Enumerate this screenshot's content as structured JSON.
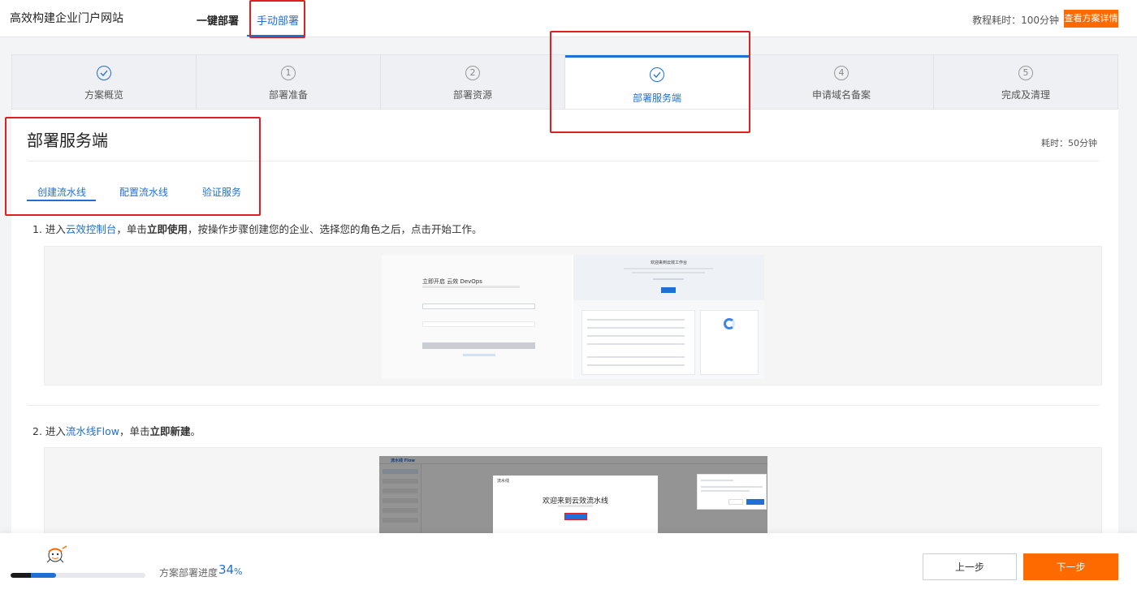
{
  "header": {
    "site_title": "高效构建企业门户网站",
    "tabs": [
      {
        "label": "一键部署"
      },
      {
        "label": "手动部署"
      }
    ],
    "course_time": "教程耗时：100分钟",
    "detail_button": "查看方案详情"
  },
  "steps": [
    {
      "label": "方案概览",
      "status": "done"
    },
    {
      "label": "部署准备",
      "number": "1"
    },
    {
      "label": "部署资源",
      "number": "2"
    },
    {
      "label": "部署服务端",
      "status": "active"
    },
    {
      "label": "申请域名备案",
      "number": "4"
    },
    {
      "label": "完成及清理",
      "number": "5"
    }
  ],
  "section": {
    "title": "部署服务端",
    "elapsed": "耗时：50分钟",
    "sub_tabs": [
      {
        "label": "创建流水线"
      },
      {
        "label": "配置流水线"
      },
      {
        "label": "验证服务"
      }
    ],
    "instructions": [
      {
        "prefix": "1. 进入",
        "link": "云效控制台",
        "mid": "，单击",
        "bold": "立即使用",
        "suffix": "，按操作步骤创建您的企业、选择您的角色之后，点击开始工作。"
      },
      {
        "prefix": "2. 进入",
        "link": "流水线Flow",
        "mid": "，单击",
        "bold": "立即新建",
        "suffix": "。"
      }
    ],
    "screenshot1": {
      "left_title": "立即开启 云效 DevOps",
      "right_title": "欢迎来到云效工作台"
    },
    "screenshot2": {
      "app_name": "流水线 Flow",
      "modal_head": "流水线",
      "modal_title": "欢迎来到云效流水线"
    }
  },
  "footer": {
    "progress_label": "方案部署进度",
    "progress_value": "34",
    "progress_unit": "%",
    "progress_fraction": 0.34,
    "prev_button": "上一步",
    "next_button": "下一步"
  },
  "colors": {
    "accent": "#1f6fd6",
    "brand_orange": "#ff6a00",
    "annotation_red": "#e02020"
  }
}
